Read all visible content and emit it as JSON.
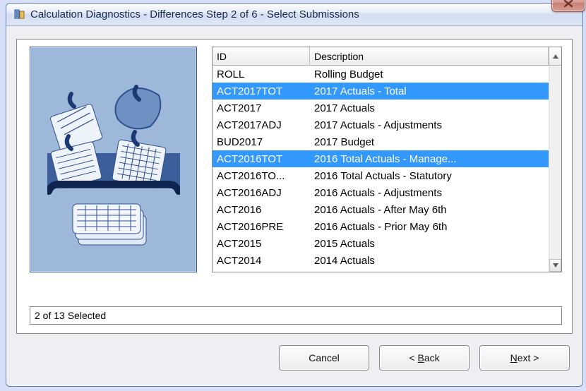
{
  "window": {
    "title": "Calculation Diagnostics - Differences Step 2 of 6 - Select Submissions"
  },
  "headers": {
    "id": "ID",
    "description": "Description"
  },
  "rows": [
    {
      "id": "ROLL",
      "desc": "Rolling Budget",
      "selected": false
    },
    {
      "id": "ACT2017TOT",
      "desc": "2017 Actuals - Total",
      "selected": true
    },
    {
      "id": "ACT2017",
      "desc": "2017 Actuals",
      "selected": false
    },
    {
      "id": "ACT2017ADJ",
      "desc": "2017 Actuals - Adjustments",
      "selected": false
    },
    {
      "id": "BUD2017",
      "desc": "2017 Budget",
      "selected": false
    },
    {
      "id": "ACT2016TOT",
      "desc": "2016 Total Actuals - Manage...",
      "selected": true
    },
    {
      "id": "ACT2016TO...",
      "desc": "2016 Total Actuals - Statutory",
      "selected": false
    },
    {
      "id": "ACT2016ADJ",
      "desc": "2016 Actuals - Adjustments",
      "selected": false
    },
    {
      "id": "ACT2016",
      "desc": "2016 Actuals - After May 6th",
      "selected": false
    },
    {
      "id": "ACT2016PRE",
      "desc": "2016 Actuals - Prior May 6th",
      "selected": false
    },
    {
      "id": "ACT2015",
      "desc": "2015 Actuals",
      "selected": false
    },
    {
      "id": "ACT2014",
      "desc": "2014 Actuals",
      "selected": false
    }
  ],
  "status": "2 of 13 Selected",
  "buttons": {
    "cancel": "Cancel",
    "back_prefix": "< ",
    "back_u": "B",
    "back_rest": "ack",
    "next_u": "N",
    "next_rest": "ext >"
  }
}
